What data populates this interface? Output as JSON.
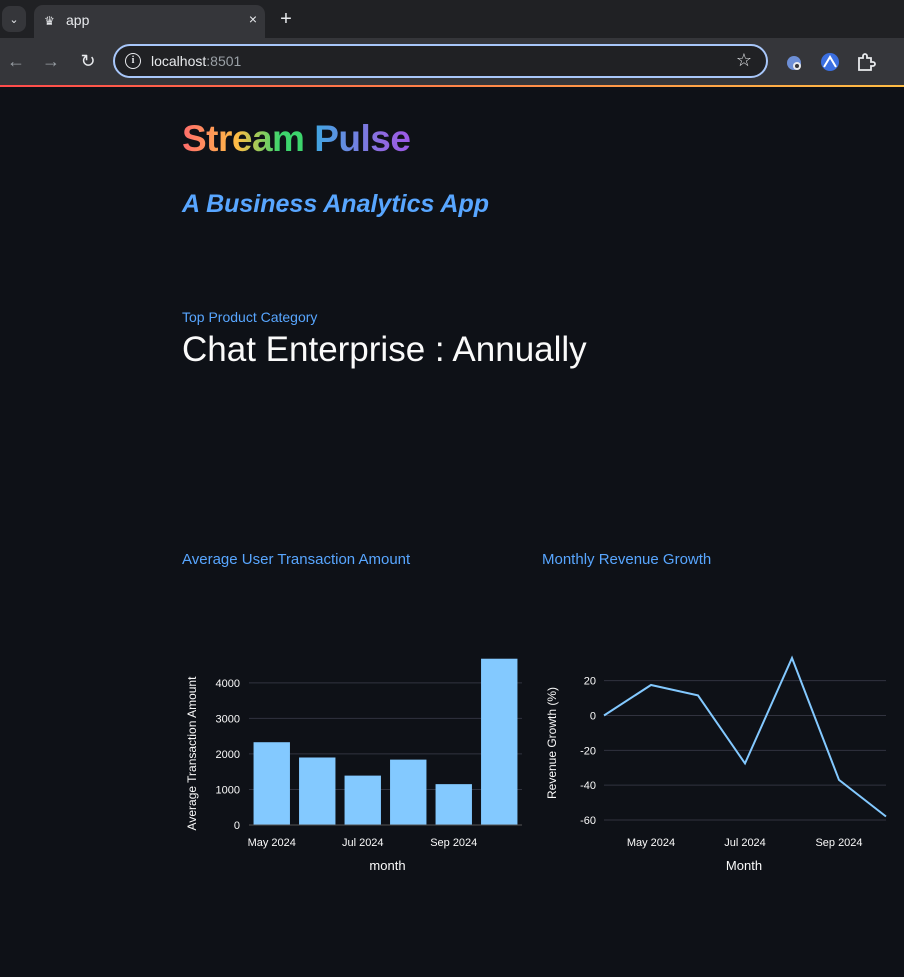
{
  "browser": {
    "tab_title": "app",
    "tab_close": "×",
    "new_tab": "+",
    "url_host": "localhost",
    "url_port": ":8501",
    "accent_colors": [
      "#ff4b4b",
      "#ffbd45"
    ]
  },
  "app": {
    "title_part1": "Stream",
    "title_part2": "Pulse",
    "subtitle": "A Business Analytics App",
    "metric": {
      "label": "Top Product Category",
      "value": "Chat Enterprise : Annually"
    }
  },
  "charts": {
    "left_title": "Average User Transaction Amount",
    "right_title": "Monthly Revenue Growth"
  },
  "chart_data": [
    {
      "type": "bar",
      "categories": [
        "2024-05",
        "2024-06",
        "2024-07",
        "2024-08",
        "2024-09",
        "2024-10"
      ],
      "values": [
        2330,
        1900,
        1390,
        1840,
        1150,
        4680
      ],
      "xlabel": "month",
      "ylabel": "Average Transaction Amount",
      "xtick_labels": [
        "May 2024",
        "Jul 2024",
        "Sep 2024"
      ],
      "yticks": [
        0,
        1000,
        2000,
        3000,
        4000
      ],
      "ylim": [
        0,
        4700
      ],
      "color": "#83c9ff",
      "grid": true
    },
    {
      "type": "line",
      "x": [
        "2024-04",
        "2024-05",
        "2024-06",
        "2024-07",
        "2024-08",
        "2024-09",
        "2024-10"
      ],
      "values": [
        0,
        17.5,
        11.5,
        -27.5,
        33,
        -37,
        -58
      ],
      "xlabel": "Month",
      "ylabel": "Revenue Growth (%)",
      "xtick_labels": [
        "May 2024",
        "Jul 2024",
        "Sep 2024"
      ],
      "yticks": [
        -60,
        -40,
        -20,
        0,
        20
      ],
      "ylim": [
        -60,
        33
      ],
      "color": "#83c9ff",
      "grid": true
    }
  ]
}
